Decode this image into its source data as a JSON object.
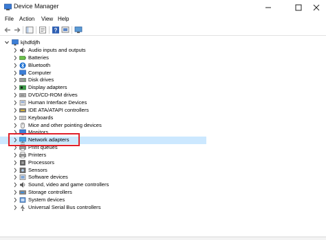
{
  "window": {
    "title": "Device Manager",
    "minimize_icon": "minimize-icon",
    "maximize_icon": "maximize-icon",
    "close_icon": "close-icon"
  },
  "menu": [
    "File",
    "Action",
    "View",
    "Help"
  ],
  "toolbar": [
    "back-arrow-icon",
    "forward-arrow-icon",
    "show-hide-console-tree-icon",
    "properties-icon",
    "help-icon",
    "update-driver-icon",
    "scan-hardware-icon"
  ],
  "tree": {
    "root": "kjhdfdjfh",
    "items": [
      {
        "label": "Audio inputs and outputs",
        "icon": "speaker-icon"
      },
      {
        "label": "Batteries",
        "icon": "battery-icon"
      },
      {
        "label": "Bluetooth",
        "icon": "bluetooth-icon"
      },
      {
        "label": "Computer",
        "icon": "computer-icon"
      },
      {
        "label": "Disk drives",
        "icon": "disk-drive-icon"
      },
      {
        "label": "Display adapters",
        "icon": "display-adapter-icon"
      },
      {
        "label": "DVD/CD-ROM drives",
        "icon": "dvd-drive-icon"
      },
      {
        "label": "Human Interface Devices",
        "icon": "hid-icon"
      },
      {
        "label": "IDE ATA/ATAPI controllers",
        "icon": "ide-controller-icon"
      },
      {
        "label": "Keyboards",
        "icon": "keyboard-icon"
      },
      {
        "label": "Mice and other pointing devices",
        "icon": "mouse-icon"
      },
      {
        "label": "Monitors",
        "icon": "monitor-icon"
      },
      {
        "label": "Network adapters",
        "icon": "network-adapter-icon"
      },
      {
        "label": "Print queues",
        "icon": "printer-icon"
      },
      {
        "label": "Printers",
        "icon": "printer-icon"
      },
      {
        "label": "Processors",
        "icon": "processor-icon"
      },
      {
        "label": "Sensors",
        "icon": "sensor-icon"
      },
      {
        "label": "Software devices",
        "icon": "software-device-icon"
      },
      {
        "label": "Sound, video and game controllers",
        "icon": "sound-icon"
      },
      {
        "label": "Storage controllers",
        "icon": "storage-icon"
      },
      {
        "label": "System devices",
        "icon": "system-device-icon"
      },
      {
        "label": "Universal Serial Bus controllers",
        "icon": "usb-icon"
      }
    ]
  },
  "colors": {
    "highlight_border": "#e0202a",
    "selected_bg": "#cce8ff"
  }
}
